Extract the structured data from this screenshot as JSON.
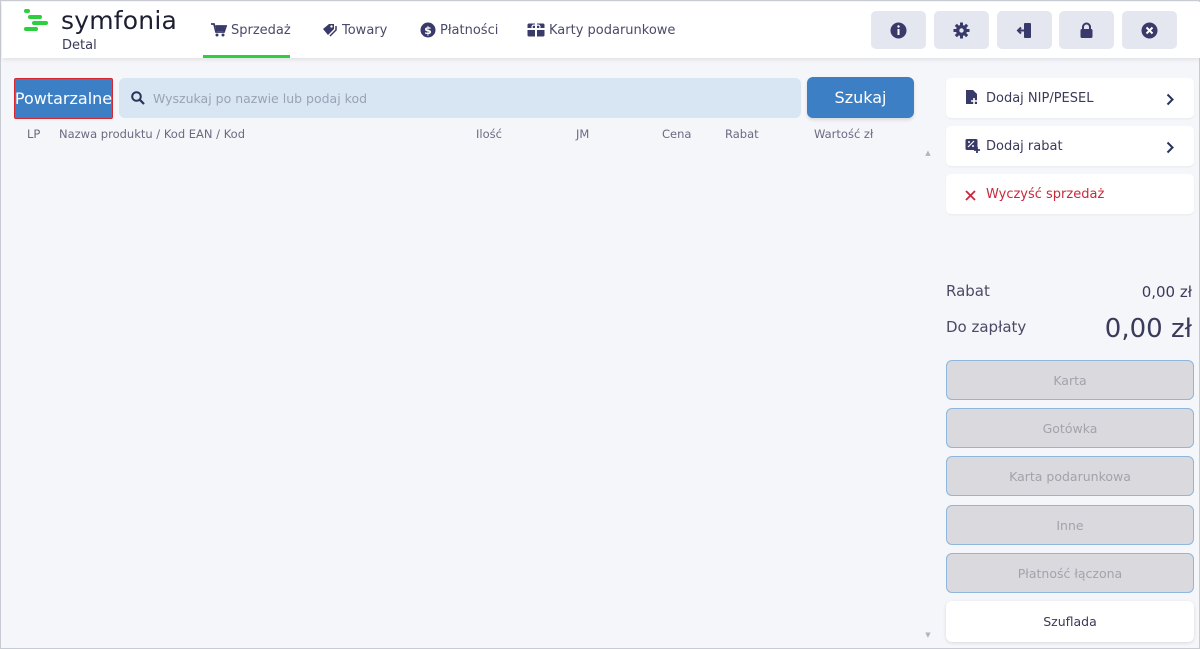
{
  "brand": {
    "name": "symfonia",
    "subtitle": "Detal",
    "accent": "#2ccf3d",
    "primary": "#3d7fc4"
  },
  "nav": {
    "tabs": [
      {
        "label": "Sprzedaż",
        "icon": "cart-icon",
        "active": true
      },
      {
        "label": "Towary",
        "icon": "tags-icon",
        "active": false
      },
      {
        "label": "Płatności",
        "icon": "dollar-circle-icon",
        "active": false
      },
      {
        "label": "Karty podarunkowe",
        "icon": "gift-card-icon",
        "active": false
      }
    ]
  },
  "header_actions": [
    {
      "name": "info",
      "icon": "info-icon"
    },
    {
      "name": "settings",
      "icon": "gear-icon"
    },
    {
      "name": "logout",
      "icon": "logout-icon"
    },
    {
      "name": "lock",
      "icon": "lock-icon"
    },
    {
      "name": "close",
      "icon": "close-circle-icon"
    }
  ],
  "sale": {
    "repeat_label": "Powtarzalne",
    "search_placeholder": "Wyszukaj po nazwie lub podaj kod",
    "search_value": "",
    "search_button": "Szukaj",
    "columns": [
      "LP",
      "Nazwa produktu / Kod EAN / Kod",
      "Ilość",
      "JM",
      "Cena",
      "Rabat",
      "Wartość zł"
    ],
    "rows": []
  },
  "side": {
    "add_nip": "Dodaj NIP/PESEL",
    "add_discount": "Dodaj rabat",
    "clear_sale": "Wyczyść sprzedaż",
    "discount_label": "Rabat",
    "discount_value": "0,00 zł",
    "total_label": "Do zapłaty",
    "total_value": "0,00 zł",
    "payments": [
      "Karta",
      "Gotówka",
      "Karta podarunkowa",
      "Inne",
      "Płatność łączona"
    ],
    "drawer": "Szuflada"
  }
}
